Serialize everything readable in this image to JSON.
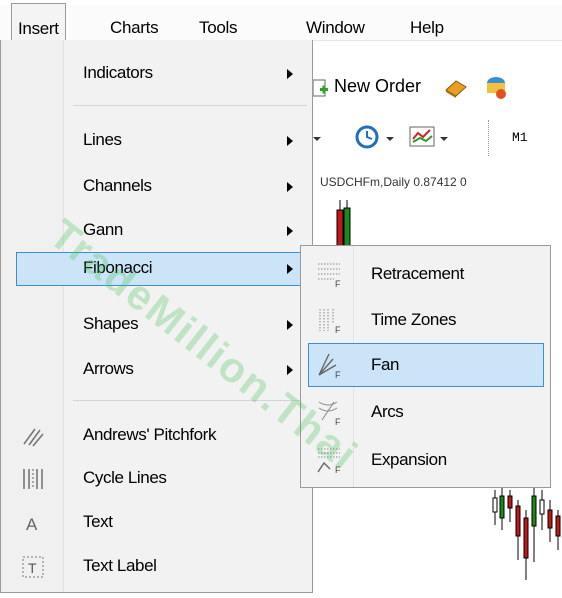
{
  "menubar": {
    "items": [
      {
        "label": "Insert"
      },
      {
        "label": "Charts"
      },
      {
        "label": "Tools"
      },
      {
        "label": "Window"
      },
      {
        "label": "Help"
      }
    ]
  },
  "toolbar": {
    "new_order_label": "New Order",
    "timeframe_label": "M1"
  },
  "chart": {
    "symbol_info": "USDCHFm,Daily  0.87412 0"
  },
  "insert_menu": {
    "items": [
      {
        "label": "Indicators",
        "submenu": true
      },
      {
        "label": "Lines",
        "submenu": true
      },
      {
        "label": "Channels",
        "submenu": true
      },
      {
        "label": "Gann",
        "submenu": true
      },
      {
        "label": "Fibonacci",
        "submenu": true,
        "highlighted": true
      },
      {
        "label": "Shapes",
        "submenu": true
      },
      {
        "label": "Arrows",
        "submenu": true
      },
      {
        "label": "Andrews' Pitchfork",
        "icon": "pitchfork-icon"
      },
      {
        "label": "Cycle Lines",
        "icon": "cycle-lines-icon"
      },
      {
        "label": "Text",
        "icon": "text-icon"
      },
      {
        "label": "Text Label",
        "icon": "text-label-icon"
      }
    ]
  },
  "fibonacci_submenu": {
    "items": [
      {
        "label": "Retracement",
        "icon": "fibo-retracement-icon"
      },
      {
        "label": "Time Zones",
        "icon": "fibo-time-zones-icon"
      },
      {
        "label": "Fan",
        "icon": "fibo-fan-icon",
        "highlighted": true
      },
      {
        "label": "Arcs",
        "icon": "fibo-arcs-icon"
      },
      {
        "label": "Expansion",
        "icon": "fibo-expansion-icon"
      }
    ]
  },
  "watermark": "TradeMillion.Thai",
  "colors": {
    "highlight_bg": "#cce4f7",
    "highlight_border": "#3d8fd4",
    "menu_bg": "#f2f2f2",
    "watermark": "#3cbe50",
    "bull_candle": "#1a8a1a",
    "bear_candle": "#c01818"
  }
}
